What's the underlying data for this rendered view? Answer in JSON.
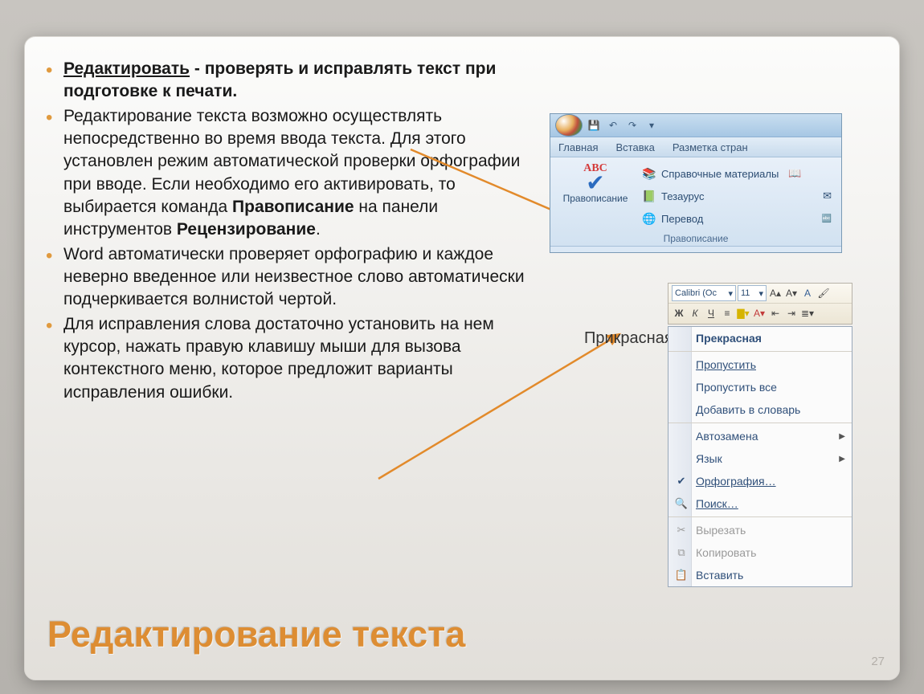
{
  "bullets": {
    "b1_lead_underline": "Редактировать",
    "b1_rest": " - проверять и исправлять текст при подготовке к печати.",
    "b2_a": "Редактирование текста возможно осуществлять непосредственно во время ввода текста. Для этого установлен режим автоматической проверки орфографии при вводе. Если необходимо его активировать, то выбирается команда ",
    "b2_bold1": "Правописание",
    "b2_b": " на панели инструментов ",
    "b2_bold2": "Рецензирование",
    "b2_c": ".",
    "b3": "Word автоматически проверяет орфографию и каждое неверно введенное или неизвестное слово автоматически подчеркивается волнистой чертой.",
    "b4": "Для исправления слова достаточно установить на нем курсор, нажать правую клавишу мыши для вызова контекстного меню, которое предложит варианты исправления ошибки."
  },
  "title": "Редактирование текста",
  "page_number": "27",
  "ribbon": {
    "tabs": [
      "Главная",
      "Вставка",
      "Разметка стран"
    ],
    "spelling_label": "Правописание",
    "items": {
      "ref": "Справочные материалы",
      "thesaurus": "Тезаурус",
      "translate": "Перевод"
    },
    "group": "Правописание"
  },
  "mini_toolbar": {
    "font_name": "Calibri (Ос",
    "font_size": "11"
  },
  "misspelled_word": "Прикрасная",
  "context_menu": {
    "suggestion": "Прекрасная",
    "skip": "Пропустить",
    "skip_all": "Пропустить все",
    "add_dict": "Добавить в словарь",
    "autocorrect": "Автозамена",
    "language": "Язык",
    "spelling": "Орфография…",
    "find": "Поиск…",
    "cut": "Вырезать",
    "copy": "Копировать",
    "paste": "Вставить"
  }
}
